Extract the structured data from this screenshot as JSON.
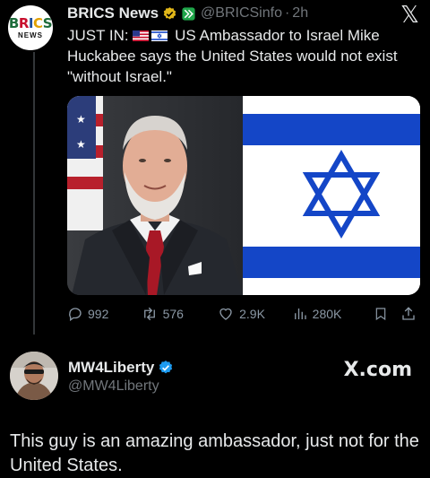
{
  "quoted_tweet": {
    "author_name": "BRICS News",
    "handle": "@BRICSinfo",
    "separator": "·",
    "time": "2h",
    "text_prefix": "JUST IN:",
    "text_main": "US Ambassador to Israel Mike Huckabee says the United States would not exist \"without Israel.\"",
    "avatar": {
      "logo_text": "BRICS",
      "sub_text": "NEWS"
    },
    "icons": [
      "verified-badge-icon",
      "affiliate-badge-icon",
      "x-logo-icon",
      "us-flag-icon",
      "israel-flag-icon"
    ],
    "stats": {
      "replies": "992",
      "retweets": "576",
      "likes": "2.9K",
      "views": "280K"
    }
  },
  "reply_tweet": {
    "author_name": "MW4Liberty",
    "handle": "@MW4Liberty",
    "site_mark": "X.com",
    "text": "This guy is an amazing ambassador, just not for the United States."
  },
  "colors": {
    "background": "#000000",
    "text": "#e7e9ea",
    "muted": "#71767b",
    "verified_gold": "#e2b719",
    "verified_blue": "#1d9bf0",
    "israel_blue": "#1446c7"
  }
}
